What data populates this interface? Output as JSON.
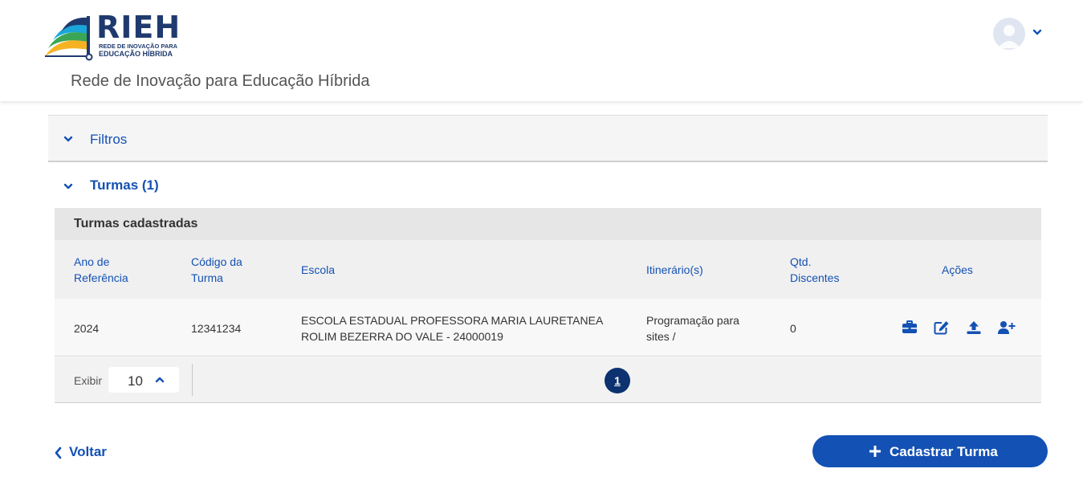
{
  "brand": {
    "logo_title": "RIEH",
    "logo_subtitle_line1": "REDE DE INOVAÇÃO PARA",
    "logo_subtitle_line2": "EDUCAÇÃO HÍBRIDA",
    "site_name": "Rede de Inovação para Educação Híbrida"
  },
  "user_menu": {
    "avatar_icon": "user-avatar-icon",
    "chevron_icon": "chevron-down-icon"
  },
  "filters": {
    "label": "Filtros"
  },
  "turmas": {
    "label": "Turmas (1)",
    "table_title": "Turmas cadastradas",
    "columns": {
      "ano_line1": "Ano de",
      "ano_line2": "Referência",
      "codigo_line1": "Código da",
      "codigo_line2": "Turma",
      "escola": "Escola",
      "itinerario": "Itinerário(s)",
      "qtd_line1": "Qtd.",
      "qtd_line2": "Discentes",
      "acoes": "Ações"
    },
    "rows": [
      {
        "ano": "2024",
        "codigo": "12341234",
        "escola_line1": "ESCOLA ESTADUAL PROFESSORA MARIA LAURETANEA",
        "escola_line2": "ROLIM BEZERRA DO VALE - 24000019",
        "itinerario_line1": "Programação para",
        "itinerario_line2": "sites /",
        "qtd": "0",
        "actions": [
          "briefcase-icon",
          "edit-icon",
          "upload-icon",
          "add-user-icon"
        ]
      }
    ],
    "pagination": {
      "exibir_label": "Exibir",
      "page_size": "10",
      "current_page": "1"
    }
  },
  "footer": {
    "voltar_label": "Voltar",
    "cadastrar_label": "Cadastrar Turma"
  },
  "colors": {
    "primary": "#1351b4",
    "dark_blue": "#0c326f",
    "logo_blue": "#1f3a6e"
  }
}
